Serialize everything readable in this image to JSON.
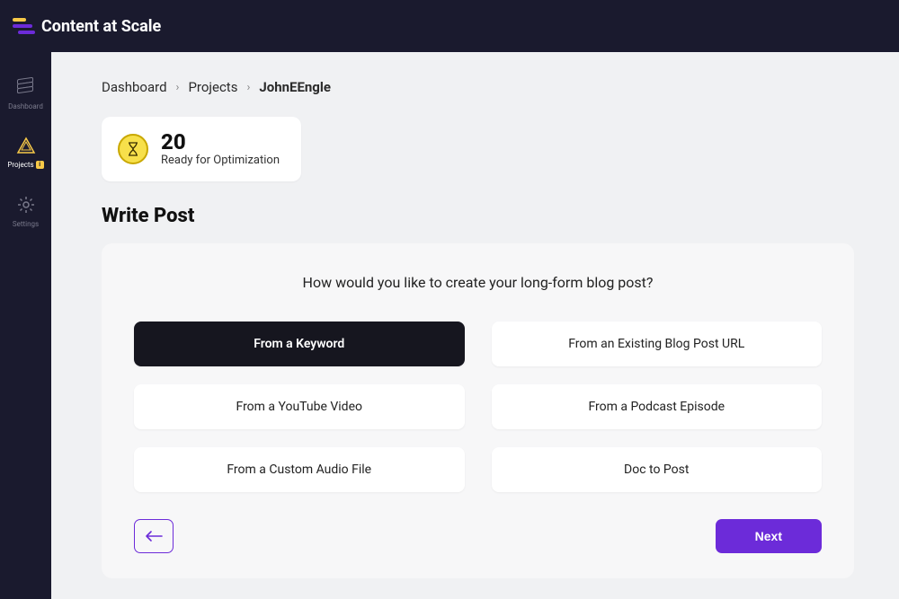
{
  "brand": "Content at Scale",
  "sidebar": {
    "items": [
      {
        "label": "Dashboard"
      },
      {
        "label": "Projects"
      },
      {
        "label": "Settings"
      }
    ]
  },
  "breadcrumb": {
    "items": [
      "Dashboard",
      "Projects"
    ],
    "current": "JohnEEngle"
  },
  "status": {
    "count": "20",
    "label": "Ready for Optimization"
  },
  "section_title": "Write Post",
  "card": {
    "prompt": "How would you like to create your long-form blog post?",
    "options": [
      "From a Keyword",
      "From an Existing Blog Post URL",
      "From a YouTube Video",
      "From a Podcast Episode",
      "From a Custom Audio File",
      "Doc to Post"
    ],
    "selected_index": 0,
    "back_label": "←",
    "next_label": "Next"
  }
}
